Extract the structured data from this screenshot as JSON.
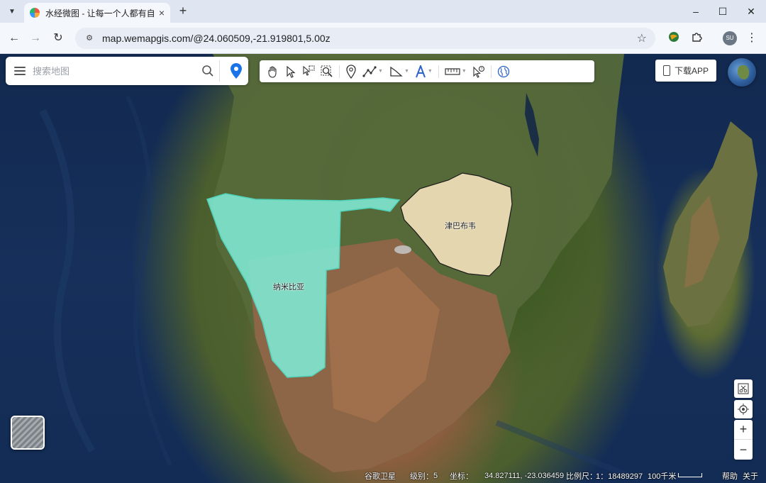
{
  "browser": {
    "tab_title": "水经微图 - 让每一个人都有自己",
    "url": "map.wemapgis.com/@24.060509,-21.919801,5.00z",
    "profile_initials": "SU"
  },
  "search": {
    "placeholder": "搜索地图"
  },
  "toolbar": {
    "tools": [
      "pan-hand",
      "select-arrow",
      "box-select",
      "zoom-to-area",
      "marker",
      "polyline",
      "polygon",
      "text",
      "measure",
      "pick-info",
      "world-view"
    ]
  },
  "download_button": {
    "label": "下载APP"
  },
  "regions": [
    {
      "name": "纳米比亚",
      "fill": "#7fead5"
    },
    {
      "name": "津巴布韦",
      "fill": "#ecdcb4"
    }
  ],
  "statusbar": {
    "source": "谷歌卫星",
    "level_label": "级别：",
    "level_value": "5",
    "coord_label": "坐标：",
    "coord_value": "34.827111, -23.036459",
    "scale_label": "比例尺：",
    "scale_value": "1：18489297",
    "scale_bar_label": "100千米",
    "help": "帮助",
    "about": "关于"
  },
  "colors": {
    "ocean": "#16305b",
    "accent_pin": "#1a73e8"
  }
}
